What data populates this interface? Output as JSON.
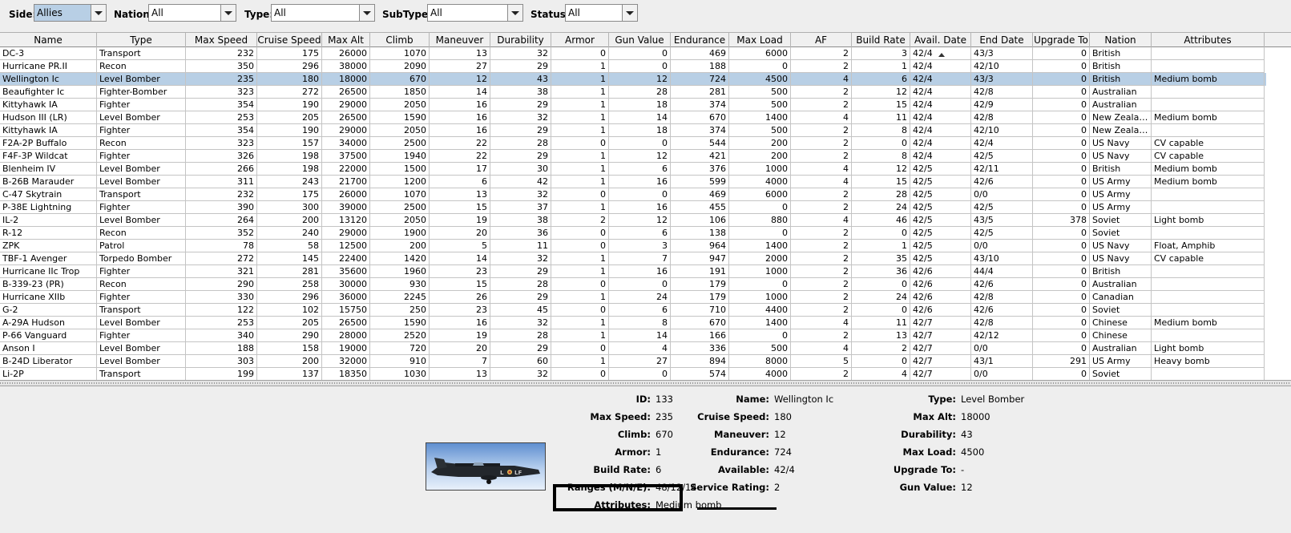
{
  "filters": {
    "side": {
      "label": "Side:",
      "value": "Allies"
    },
    "nation": {
      "label": "Nation:",
      "value": "All"
    },
    "type": {
      "label": "Type:",
      "value": "All"
    },
    "subtype": {
      "label": "SubType:",
      "value": "All"
    },
    "status": {
      "label": "Status:",
      "value": "All"
    }
  },
  "table": {
    "columns": [
      "Name",
      "Type",
      "Max Speed",
      "Cruise Speed",
      "Max Alt",
      "Climb",
      "Maneuver",
      "Durability",
      "Armor",
      "Gun Value",
      "Endurance",
      "Max Load",
      "AF",
      "Build Rate",
      "Avail. Date",
      "End Date",
      "Upgrade To",
      "Nation",
      "Attributes"
    ],
    "sorted_column": "Avail. Date",
    "selected_row": 2,
    "rows": [
      [
        "DC-3",
        "Transport",
        "232",
        "175",
        "26000",
        "1070",
        "13",
        "32",
        "0",
        "0",
        "469",
        "6000",
        "2",
        "3",
        "42/4",
        "43/3",
        "0",
        "British",
        ""
      ],
      [
        "Hurricane PR.II",
        "Recon",
        "350",
        "296",
        "38000",
        "2090",
        "27",
        "29",
        "1",
        "0",
        "188",
        "0",
        "2",
        "1",
        "42/4",
        "42/10",
        "0",
        "British",
        ""
      ],
      [
        "Wellington Ic",
        "Level Bomber",
        "235",
        "180",
        "18000",
        "670",
        "12",
        "43",
        "1",
        "12",
        "724",
        "4500",
        "4",
        "6",
        "42/4",
        "43/3",
        "0",
        "British",
        "Medium bomb"
      ],
      [
        "Beaufighter Ic",
        "Fighter-Bomber",
        "323",
        "272",
        "26500",
        "1850",
        "14",
        "38",
        "1",
        "28",
        "281",
        "500",
        "2",
        "12",
        "42/4",
        "42/8",
        "0",
        "Australian",
        ""
      ],
      [
        "Kittyhawk IA",
        "Fighter",
        "354",
        "190",
        "29000",
        "2050",
        "16",
        "29",
        "1",
        "18",
        "374",
        "500",
        "2",
        "15",
        "42/4",
        "42/9",
        "0",
        "Australian",
        ""
      ],
      [
        "Hudson III (LR)",
        "Level Bomber",
        "253",
        "205",
        "26500",
        "1590",
        "16",
        "32",
        "1",
        "14",
        "670",
        "1400",
        "4",
        "11",
        "42/4",
        "42/8",
        "0",
        "New Zealand",
        "Medium bomb"
      ],
      [
        "Kittyhawk IA",
        "Fighter",
        "354",
        "190",
        "29000",
        "2050",
        "16",
        "29",
        "1",
        "18",
        "374",
        "500",
        "2",
        "8",
        "42/4",
        "42/10",
        "0",
        "New Zealand",
        ""
      ],
      [
        "F2A-2P Buffalo",
        "Recon",
        "323",
        "157",
        "34000",
        "2500",
        "22",
        "28",
        "0",
        "0",
        "544",
        "200",
        "2",
        "0",
        "42/4",
        "42/4",
        "0",
        "US Navy",
        "CV capable"
      ],
      [
        "F4F-3P Wildcat",
        "Fighter",
        "326",
        "198",
        "37500",
        "1940",
        "22",
        "29",
        "1",
        "12",
        "421",
        "200",
        "2",
        "8",
        "42/4",
        "42/5",
        "0",
        "US Navy",
        "CV capable"
      ],
      [
        "Blenheim IV",
        "Level Bomber",
        "266",
        "198",
        "22000",
        "1500",
        "17",
        "30",
        "1",
        "6",
        "376",
        "1000",
        "4",
        "12",
        "42/5",
        "42/11",
        "0",
        "British",
        "Medium bomb"
      ],
      [
        "B-26B Marauder",
        "Level Bomber",
        "311",
        "243",
        "21700",
        "1200",
        "6",
        "42",
        "1",
        "16",
        "599",
        "4000",
        "4",
        "15",
        "42/5",
        "42/6",
        "0",
        "US Army",
        "Medium bomb"
      ],
      [
        "C-47 Skytrain",
        "Transport",
        "232",
        "175",
        "26000",
        "1070",
        "13",
        "32",
        "0",
        "0",
        "469",
        "6000",
        "2",
        "28",
        "42/5",
        "0/0",
        "0",
        "US Army",
        ""
      ],
      [
        "P-38E Lightning",
        "Fighter",
        "390",
        "300",
        "39000",
        "2500",
        "15",
        "37",
        "1",
        "16",
        "455",
        "0",
        "2",
        "24",
        "42/5",
        "42/5",
        "0",
        "US Army",
        ""
      ],
      [
        "IL-2",
        "Level Bomber",
        "264",
        "200",
        "13120",
        "2050",
        "19",
        "38",
        "2",
        "12",
        "106",
        "880",
        "4",
        "46",
        "42/5",
        "43/5",
        "378",
        "Soviet",
        "Light bomb"
      ],
      [
        "R-12",
        "Recon",
        "352",
        "240",
        "29000",
        "1900",
        "20",
        "36",
        "0",
        "6",
        "138",
        "0",
        "2",
        "0",
        "42/5",
        "42/5",
        "0",
        "Soviet",
        ""
      ],
      [
        "ZPK",
        "Patrol",
        "78",
        "58",
        "12500",
        "200",
        "5",
        "11",
        "0",
        "3",
        "964",
        "1400",
        "2",
        "1",
        "42/5",
        "0/0",
        "0",
        "US Navy",
        "Float, Amphib"
      ],
      [
        "TBF-1 Avenger",
        "Torpedo Bomber",
        "272",
        "145",
        "22400",
        "1420",
        "14",
        "32",
        "1",
        "7",
        "947",
        "2000",
        "2",
        "35",
        "42/5",
        "43/10",
        "0",
        "US Navy",
        "CV capable"
      ],
      [
        "Hurricane IIc Trop",
        "Fighter",
        "321",
        "281",
        "35600",
        "1960",
        "23",
        "29",
        "1",
        "16",
        "191",
        "1000",
        "2",
        "36",
        "42/6",
        "44/4",
        "0",
        "British",
        ""
      ],
      [
        "B-339-23 (PR)",
        "Recon",
        "290",
        "258",
        "30000",
        "930",
        "15",
        "28",
        "0",
        "0",
        "179",
        "0",
        "2",
        "0",
        "42/6",
        "42/6",
        "0",
        "Australian",
        ""
      ],
      [
        "Hurricane XIIb",
        "Fighter",
        "330",
        "296",
        "36000",
        "2245",
        "26",
        "29",
        "1",
        "24",
        "179",
        "1000",
        "2",
        "24",
        "42/6",
        "42/8",
        "0",
        "Canadian",
        ""
      ],
      [
        "G-2",
        "Transport",
        "122",
        "102",
        "15750",
        "250",
        "23",
        "45",
        "0",
        "6",
        "710",
        "4400",
        "2",
        "0",
        "42/6",
        "42/6",
        "0",
        "Soviet",
        ""
      ],
      [
        "A-29A Hudson",
        "Level Bomber",
        "253",
        "205",
        "26500",
        "1590",
        "16",
        "32",
        "1",
        "8",
        "670",
        "1400",
        "4",
        "11",
        "42/7",
        "42/8",
        "0",
        "Chinese",
        "Medium bomb"
      ],
      [
        "P-66 Vanguard",
        "Fighter",
        "340",
        "290",
        "28000",
        "2520",
        "19",
        "28",
        "1",
        "14",
        "166",
        "0",
        "2",
        "13",
        "42/7",
        "42/12",
        "0",
        "Chinese",
        ""
      ],
      [
        "Anson I",
        "Level Bomber",
        "188",
        "158",
        "19000",
        "720",
        "20",
        "29",
        "0",
        "4",
        "336",
        "500",
        "4",
        "2",
        "42/7",
        "0/0",
        "0",
        "Australian",
        "Light bomb"
      ],
      [
        "B-24D Liberator",
        "Level Bomber",
        "303",
        "200",
        "32000",
        "910",
        "7",
        "60",
        "1",
        "27",
        "894",
        "8000",
        "5",
        "0",
        "42/7",
        "43/1",
        "291",
        "US Army",
        "Heavy bomb"
      ],
      [
        "Li-2P",
        "Transport",
        "199",
        "137",
        "18350",
        "1030",
        "13",
        "32",
        "0",
        "0",
        "574",
        "4000",
        "2",
        "4",
        "42/7",
        "0/0",
        "0",
        "Soviet",
        ""
      ]
    ]
  },
  "details": {
    "image_icon": "wellington-bomber-image",
    "fields": [
      {
        "label": "ID:",
        "value": "133"
      },
      {
        "label": "Max Speed:",
        "value": "235"
      },
      {
        "label": "Climb:",
        "value": "670"
      },
      {
        "label": "Armor:",
        "value": "1"
      },
      {
        "label": "Build Rate:",
        "value": "6"
      },
      {
        "label": "Ranges (M/N/E):",
        "value": "48/12/14"
      },
      {
        "label": "Attributes:",
        "value": "Medium bomb"
      },
      {
        "label": "Name:",
        "value": "Wellington Ic"
      },
      {
        "label": "Cruise Speed:",
        "value": "180"
      },
      {
        "label": "Maneuver:",
        "value": "12"
      },
      {
        "label": "Endurance:",
        "value": "724"
      },
      {
        "label": "Available:",
        "value": "42/4"
      },
      {
        "label": "Service Rating:",
        "value": "2"
      },
      {
        "label": "Type:",
        "value": "Level Bomber"
      },
      {
        "label": "Max Alt:",
        "value": "18000"
      },
      {
        "label": "Durability:",
        "value": "43"
      },
      {
        "label": "Max Load:",
        "value": "4500"
      },
      {
        "label": "Upgrade To:",
        "value": "-"
      },
      {
        "label": "Gun Value:",
        "value": "12"
      }
    ]
  },
  "colors": {
    "selected_row": "#b8cfe5",
    "highlight_box": "#000000"
  }
}
